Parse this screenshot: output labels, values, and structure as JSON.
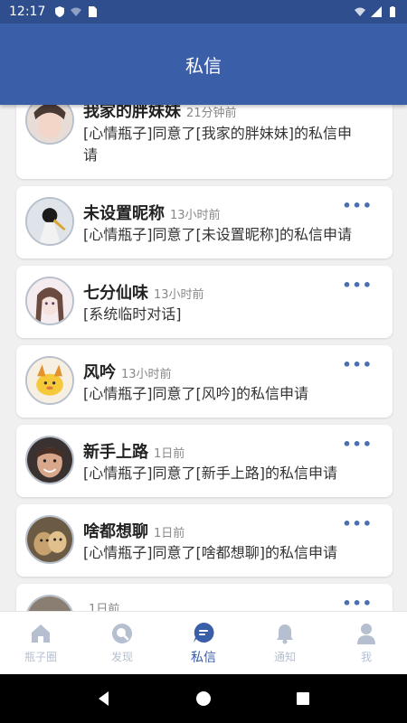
{
  "status_bar": {
    "time": "12:17"
  },
  "header": {
    "title": "私信"
  },
  "messages": [
    {
      "name": "我家的胖妹妹",
      "time": "21分钟前",
      "text": "[心情瓶子]同意了[我家的胖妹妹]的私信申请",
      "more": "•••"
    },
    {
      "name": "未设置昵称",
      "time": "13小时前",
      "text": "[心情瓶子]同意了[未设置昵称]的私信申请",
      "more": "•••"
    },
    {
      "name": "七分仙味",
      "time": "13小时前",
      "text": "[系统临时对话]",
      "more": "•••"
    },
    {
      "name": "风吟",
      "time": "13小时前",
      "text": "[心情瓶子]同意了[风吟]的私信申请",
      "more": "•••"
    },
    {
      "name": "新手上路",
      "time": "1日前",
      "text": "[心情瓶子]同意了[新手上路]的私信申请",
      "more": "•••"
    },
    {
      "name": "啥都想聊",
      "time": "1日前",
      "text": "[心情瓶子]同意了[啥都想聊]的私信申请",
      "more": "•••"
    },
    {
      "name": "",
      "time": "1日前",
      "text": "",
      "more": "•••"
    }
  ],
  "bottom_nav": [
    {
      "label": "瓶子圈",
      "icon": "home-icon"
    },
    {
      "label": "发现",
      "icon": "discover-icon"
    },
    {
      "label": "私信",
      "icon": "chat-icon",
      "active": true
    },
    {
      "label": "通知",
      "icon": "bell-icon"
    },
    {
      "label": "我",
      "icon": "person-icon"
    }
  ],
  "colors": {
    "primary": "#3b5ea8",
    "status_bar": "#2f4e8d",
    "inactive_nav": "#b5bfd0"
  }
}
